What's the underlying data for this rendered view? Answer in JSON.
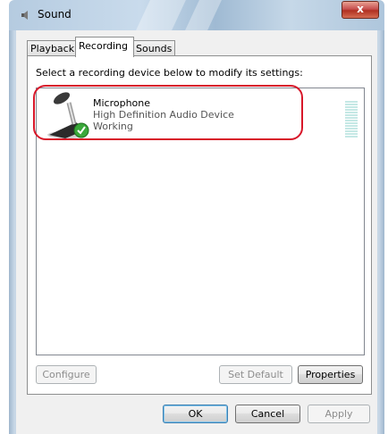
{
  "window": {
    "title": "Sound",
    "close_glyph": "x"
  },
  "tabs": [
    {
      "label": "Playback",
      "active": false
    },
    {
      "label": "Recording",
      "active": true
    },
    {
      "label": "Sounds",
      "active": false
    }
  ],
  "instruction": "Select a recording device below to modify its settings:",
  "device": {
    "name": "Microphone",
    "description": "High Definition Audio Device",
    "status": "Working",
    "icon": "microphone-icon",
    "status_icon": "green-check-icon",
    "meter_level": 0
  },
  "buttons": {
    "configure": "Configure",
    "set_default": "Set Default",
    "properties": "Properties",
    "ok": "OK",
    "cancel": "Cancel",
    "apply": "Apply"
  },
  "colors": {
    "highlight": "#d8182a",
    "check": "#3aa83a",
    "close": "#c75050"
  }
}
